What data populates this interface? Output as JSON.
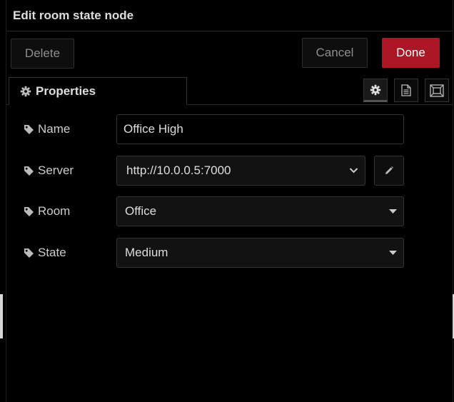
{
  "dialog": {
    "title": "Edit room state node"
  },
  "toolbar": {
    "delete_label": "Delete",
    "cancel_label": "Cancel",
    "done_label": "Done"
  },
  "tabs": {
    "properties_label": "Properties",
    "icons": [
      "gear-icon",
      "document-icon",
      "appearance-icon"
    ]
  },
  "form": {
    "name": {
      "label": "Name",
      "value": "Office High"
    },
    "server": {
      "label": "Server",
      "value": "http://10.0.0.5:7000"
    },
    "room": {
      "label": "Room",
      "value": "Office"
    },
    "state": {
      "label": "State",
      "value": "Medium"
    }
  },
  "colors": {
    "accent_done": "#ad1625",
    "background": "#000000",
    "text": "#cccccc"
  }
}
